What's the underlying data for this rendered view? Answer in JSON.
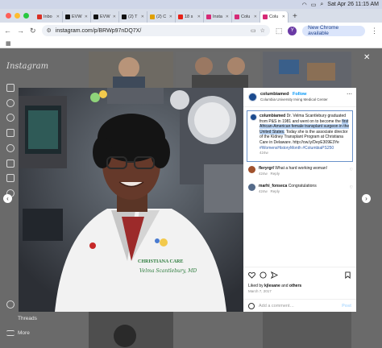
{
  "menubar": {
    "date_time": "Sat Apr 26  11:15 AM"
  },
  "browser": {
    "tabs": [
      {
        "label": "Inbo",
        "color": "#d93025"
      },
      {
        "label": "EVW",
        "color": "#111111"
      },
      {
        "label": "EVW",
        "color": "#111111"
      },
      {
        "label": "(2) T",
        "color": "#111111"
      },
      {
        "label": "(2) C",
        "color": "#e0a000"
      },
      {
        "label": "18 s",
        "color": "#e62117"
      },
      {
        "label": "Insta",
        "color": "#d62976"
      },
      {
        "label": "Colu",
        "color": "#d62976"
      },
      {
        "label": "Colu",
        "color": "#d62976"
      }
    ],
    "url": "instagram.com/p/BRWp97nDQ7X/",
    "new_chrome_label": "New Chrome available",
    "profile_initial": "Y"
  },
  "sidebar": {
    "logo": "Instagram",
    "threads_label": "Threads",
    "more_label": "More"
  },
  "post": {
    "username": "columbiamed",
    "follow_label": "Follow",
    "separator": "•",
    "location": "Columbia University Irving Medical Center",
    "caption": {
      "username": "columbiamed",
      "part1": " Dr. Velma Scantlebury graduated from P&S in 1981 and went on to become the ",
      "highlight": "first African-American female transplant surgeon in the United States.",
      "part2": " Today she is the associate director of the Kidney Transplant Program at Christiana Care in Delaware. http://ow.ly/DeyE309E3Ye ",
      "tags": "#WomensHistoryMonth #ColumbiaPS250",
      "time": "424w"
    },
    "comments": [
      {
        "user": "fleryrgrl",
        "text": "What a hard working woman!",
        "time": "424w",
        "reply": "Reply"
      },
      {
        "user": "marhi_fonseca",
        "text": "Congratulations",
        "time": "424w",
        "reply": "Reply"
      }
    ],
    "likes_prefix": "Liked by ",
    "likes_user": "kjlesane",
    "likes_and": " and ",
    "likes_others": "others",
    "date": "March 7, 2017",
    "add_comment_placeholder": "Add a comment…",
    "post_label": "Post"
  },
  "photo": {
    "badge_org": "CHRISTIANA CARE",
    "badge_name": "Velma Scantlebury, MD"
  }
}
